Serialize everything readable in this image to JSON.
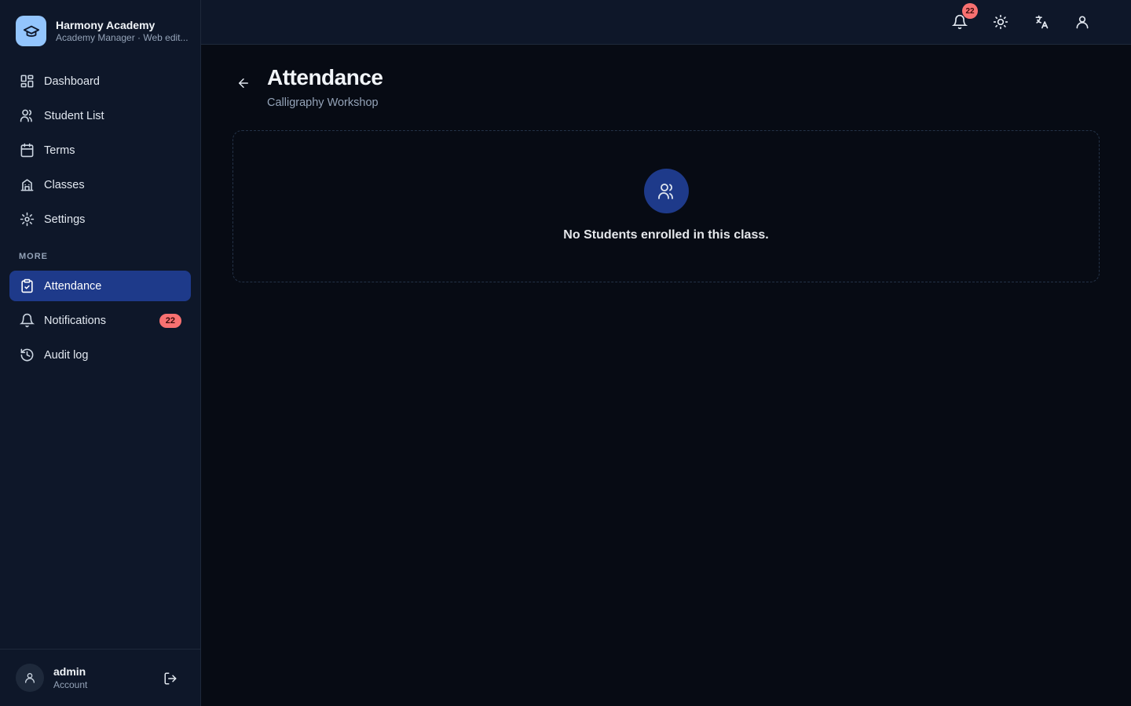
{
  "brand": {
    "name": "Harmony Academy",
    "subtitle": "Academy Manager · Web edit..."
  },
  "sidebar": {
    "items": [
      {
        "label": "Dashboard",
        "icon": "dashboard-icon"
      },
      {
        "label": "Student List",
        "icon": "users-icon"
      },
      {
        "label": "Terms",
        "icon": "calendar-icon"
      },
      {
        "label": "Classes",
        "icon": "building-icon"
      },
      {
        "label": "Settings",
        "icon": "gear-icon"
      }
    ],
    "more_label": "MORE",
    "more_items": [
      {
        "label": "Attendance",
        "icon": "clipboard-icon",
        "active": true
      },
      {
        "label": "Notifications",
        "icon": "bell-icon",
        "badge": "22"
      },
      {
        "label": "Audit log",
        "icon": "history-icon"
      }
    ]
  },
  "user": {
    "name": "admin",
    "role": "Account"
  },
  "topbar": {
    "notification_count": "22"
  },
  "page": {
    "title": "Attendance",
    "subtitle": "Calligraphy Workshop"
  },
  "empty_state": {
    "message": "No Students enrolled in this class."
  },
  "colors": {
    "accent": "#1e3a8a",
    "badge": "#f87171",
    "logo_bg": "#93c5fd"
  }
}
